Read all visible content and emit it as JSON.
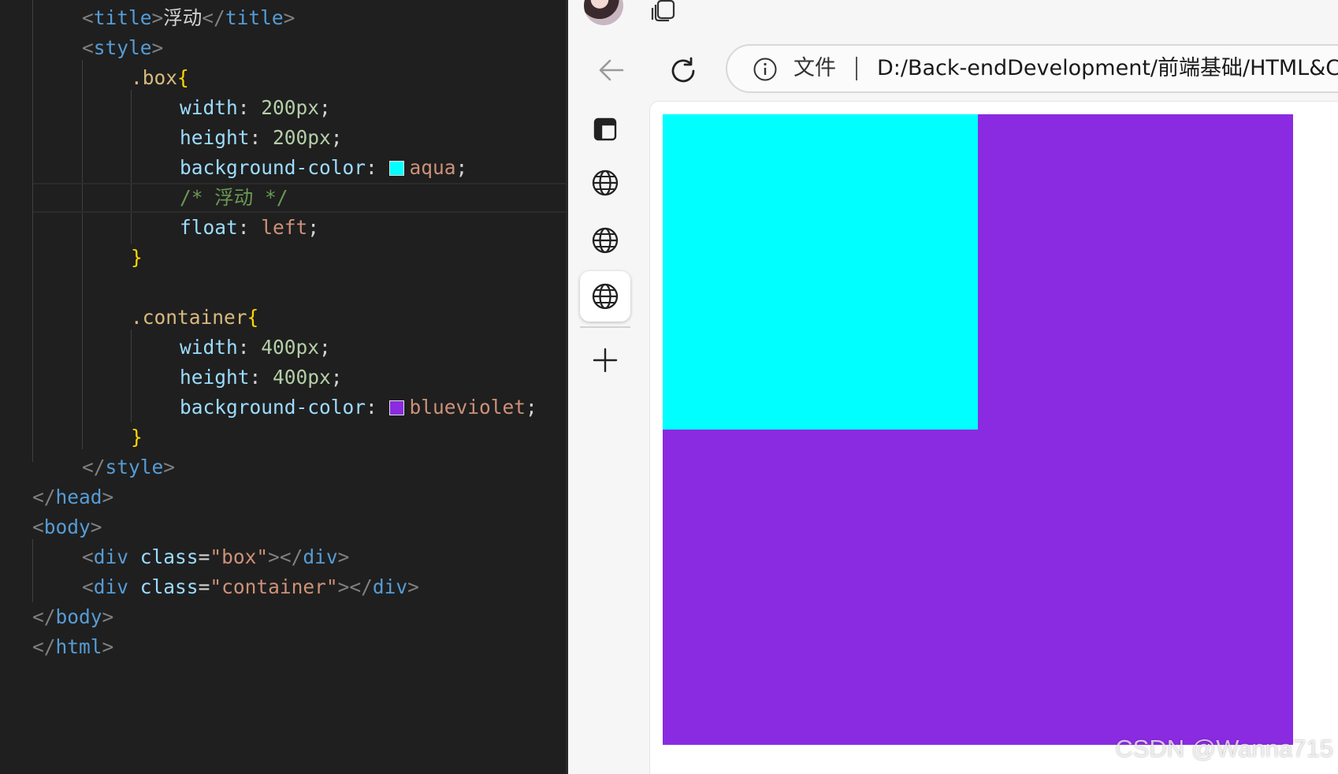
{
  "editor": {
    "lines": {
      "l1": {
        "title_text": "浮动"
      },
      "l2": {},
      "l3": {
        "selector": ".box"
      },
      "l4": {
        "prop": "width",
        "num": "200px"
      },
      "l5": {
        "prop": "height",
        "num": "200px"
      },
      "l6": {
        "prop": "background-color",
        "val": "aqua",
        "swatch": "#00ffff"
      },
      "l7": {
        "comment": "/* 浮动 */"
      },
      "l8": {
        "prop": "float",
        "val": "left"
      },
      "l9": {},
      "l11": {
        "selector": ".container"
      },
      "l12": {
        "prop": "width",
        "num": "400px"
      },
      "l13": {
        "prop": "height",
        "num": "400px"
      },
      "l14": {
        "prop": "background-color",
        "val": "blueviolet",
        "swatch": "#8a2be2"
      },
      "l19": {
        "class_value": "\"box\""
      },
      "l20": {
        "class_value": "\"container\""
      }
    },
    "tags": {
      "title": "title",
      "style": "style",
      "head": "head",
      "body": "body",
      "div": "div",
      "html": "html",
      "class_attr": "class"
    }
  },
  "browser": {
    "address": {
      "scheme_label": "文件",
      "url": "D:/Back-endDevelopment/前端基础/HTML&CSS"
    },
    "icons": {
      "back": "back-arrow-icon",
      "refresh": "refresh-icon",
      "info": "info-icon",
      "collections": "collections-icon",
      "sidebar": "sidebar-icon",
      "globe": "globe-icon",
      "add": "plus-icon"
    },
    "demo": {
      "box_color": "#00ffff",
      "container_color": "#8a2be2"
    },
    "watermark": "CSDN @Wanna715"
  }
}
